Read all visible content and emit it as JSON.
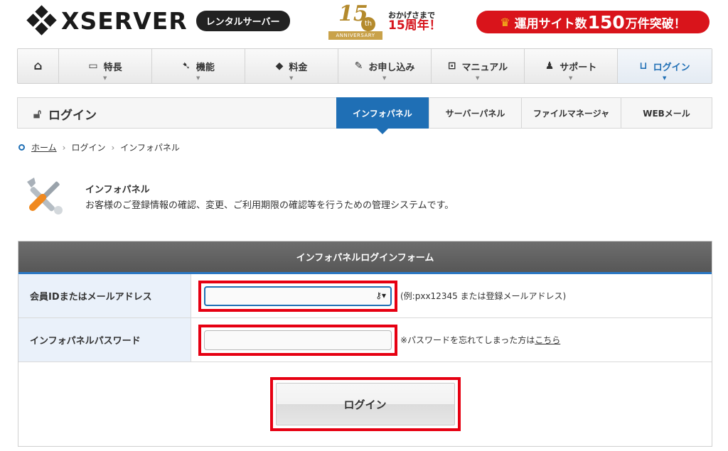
{
  "header": {
    "logo_text": "XSERVER",
    "logo_tag": "レンタルサーバー",
    "anniversary": {
      "number": "15",
      "suffix": "th",
      "ribbon": "ANNIVERSARY",
      "line1": "おかげさまで",
      "line2": "15周年！"
    },
    "promo": {
      "prefix": "運用サイト数",
      "number": "150",
      "suffix": "万件突破！"
    }
  },
  "gnav": [
    {
      "label": "",
      "icon": "home-icon",
      "glyph": "⌂"
    },
    {
      "label": "特長",
      "icon": "monitor-icon",
      "glyph": "▭"
    },
    {
      "label": "機能",
      "icon": "cursor-icon",
      "glyph": "➷"
    },
    {
      "label": "料金",
      "icon": "tag-icon",
      "glyph": "◆"
    },
    {
      "label": "お申し込み",
      "icon": "pencil-icon",
      "glyph": "✎"
    },
    {
      "label": "マニュアル",
      "icon": "book-icon",
      "glyph": "⊡"
    },
    {
      "label": "サポート",
      "icon": "person-icon",
      "glyph": "♟"
    },
    {
      "label": "ログイン",
      "icon": "unlock-icon",
      "glyph": "⊔"
    }
  ],
  "subnav": {
    "title": "ログイン",
    "tabs": [
      "インフォパネル",
      "サーバーパネル",
      "ファイルマネージャ",
      "WEBメール"
    ]
  },
  "breadcrumb": {
    "home": "ホーム",
    "level1": "ログイン",
    "current": "インフォパネル"
  },
  "intro": {
    "title": "インフォパネル",
    "description": "お客様のご登録情報の確認、変更、ご利用期限の確認等を行うための管理システムです。"
  },
  "form": {
    "heading": "インフォパネルログインフォーム",
    "id_label": "会員IDまたはメールアドレス",
    "id_value": "",
    "id_hint": "(例:pxx12345 または登録メールアドレス)",
    "password_label": "インフォパネルパスワード",
    "password_value": "",
    "password_hint": "※パスワードを忘れてしまった方は",
    "password_link": "こちら",
    "submit_label": "ログイン"
  },
  "colors": {
    "accent": "#1f6fb5",
    "highlight": "#e60012",
    "promo": "#d9141b"
  }
}
